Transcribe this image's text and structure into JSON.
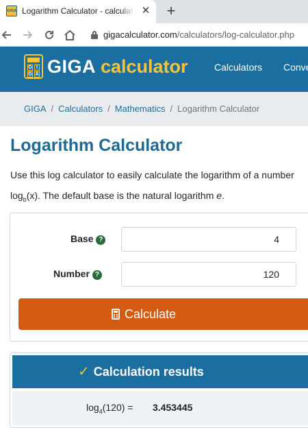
{
  "browser": {
    "tab_title": "Logarithm Calculator - calculate",
    "tab_close": "✕",
    "new_tab": "+",
    "url_domain": "gigacalculator.com",
    "url_path": "/calculators/log-calculator.php"
  },
  "header": {
    "logo_giga": "GIGA",
    "logo_calculator": "calculator",
    "logo_icon_letters": [
      "G",
      "I",
      "G",
      "A"
    ],
    "nav": [
      "Calculators",
      "Conve"
    ]
  },
  "breadcrumb": [
    "GIGA",
    "Calculators",
    "Mathematics",
    "Logarithm Calculator"
  ],
  "page": {
    "title": "Logarithm Calculator",
    "intro_line1": "Use this log calculator to easily calculate the logarithm of a number",
    "intro_log": "log",
    "intro_sub": "b",
    "intro_line2_rest": "(x). The default base is the natural logarithm ",
    "intro_e": "e",
    "intro_end": "."
  },
  "form": {
    "base_label": "Base",
    "base_value": "4",
    "number_label": "Number",
    "number_value": "120",
    "help_glyph": "?",
    "calculate_label": "Calculate"
  },
  "results": {
    "header": "Calculation results",
    "log_prefix": "log",
    "log_base": "4",
    "log_arg": "(120) =",
    "value": "3.453445"
  },
  "colors": {
    "brand_blue": "#1b6fa0",
    "brand_yellow": "#f6c33b",
    "button_orange": "#d35b12",
    "title_blue": "#1e6a94"
  }
}
